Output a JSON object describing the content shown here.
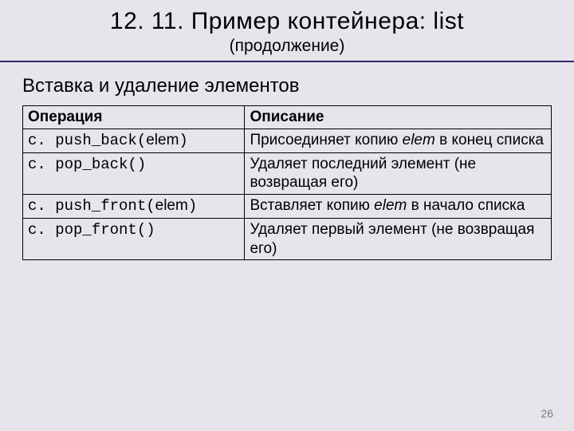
{
  "title": "12. 11. Пример контейнера: list",
  "subtitle": "(продолжение)",
  "section_heading": "Вставка и удаление элементов",
  "table": {
    "headers": {
      "op": "Операция",
      "desc": "Описание"
    },
    "rows": [
      {
        "op_pre": "c. push_back(",
        "op_param": "elem",
        "op_post": ")",
        "desc_pre": "Присоединяет копию ",
        "desc_term": "elem",
        "desc_post": " в конец списка"
      },
      {
        "op_pre": "c. pop_back()",
        "op_param": "",
        "op_post": "",
        "desc_pre": "Удаляет последний элемент (не возвращая его)",
        "desc_term": "",
        "desc_post": ""
      },
      {
        "op_pre": "c. push_front(",
        "op_param": "elem",
        "op_post": ")",
        "desc_pre": "Вставляет копию ",
        "desc_term": "elem",
        "desc_post": " в начало списка"
      },
      {
        "op_pre": "c. pop_front()",
        "op_param": "",
        "op_post": "",
        "desc_pre": "Удаляет первый элемент (не возвращая его)",
        "desc_term": "",
        "desc_post": ""
      }
    ]
  },
  "page_number": "26"
}
